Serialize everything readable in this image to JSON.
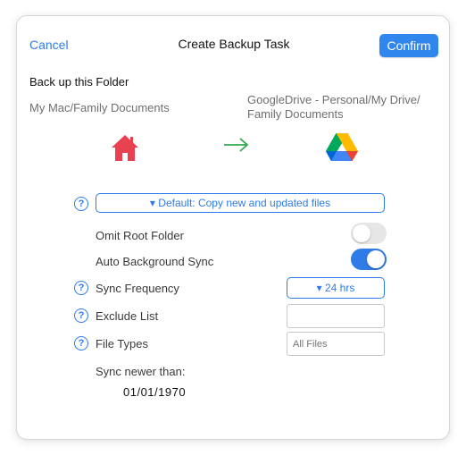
{
  "header": {
    "cancel_label": "Cancel",
    "title": "Create Backup Task",
    "confirm_label": "Confirm"
  },
  "source": {
    "heading": "Back up this Folder",
    "path": "My Mac/Family Documents",
    "icon": "house-icon"
  },
  "destination": {
    "path_line1": "GoogleDrive - Personal/My Drive/",
    "path_line2": "Family Documents",
    "icon": "google-drive-icon"
  },
  "transfer_arrow_icon": "arrow-right-icon",
  "mode": {
    "label": "▾ Default: Copy new and updated files"
  },
  "options": {
    "omit_root_label": "Omit Root Folder",
    "omit_root_on": false,
    "auto_sync_label": "Auto Background Sync",
    "auto_sync_on": true,
    "sync_frequency_label": "Sync Frequency",
    "sync_frequency_value": "▾ 24 hrs",
    "exclude_list_label": "Exclude List",
    "exclude_list_value": "",
    "file_types_label": "File Types",
    "file_types_placeholder": "All Files",
    "sync_newer_label": "Sync newer than:",
    "sync_newer_date": "01/01/1970"
  },
  "help_glyph": "?",
  "colors": {
    "accent": "#2f7be7",
    "confirm_bg": "#2f86ec",
    "house": "#e8414f",
    "arrow": "#2faa4e"
  }
}
